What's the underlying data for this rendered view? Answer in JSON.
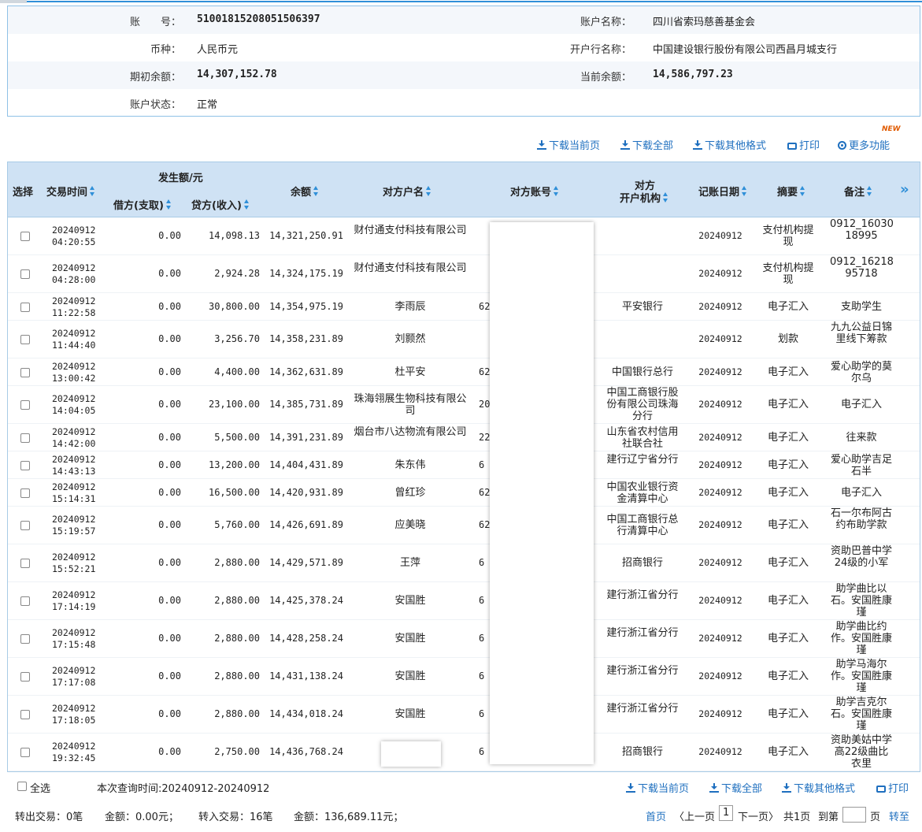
{
  "account": {
    "acct_no_label": "账　　号：",
    "acct_no": "51001815208051506397",
    "acct_name_label": "账户名称：",
    "acct_name": "四川省索玛慈善基金会",
    "currency_label": "币种：",
    "currency": "人民币元",
    "bank_label": "开户行名称：",
    "bank": "中国建设银行股份有限公司西昌月城支行",
    "open_bal_label": "期初余额：",
    "open_bal": "14,307,152.78",
    "cur_bal_label": "当前余额：",
    "cur_bal": "14,586,797.23",
    "status_label": "账户状态：",
    "status": "正常"
  },
  "toolbar": {
    "dl_page": "下载当前页",
    "dl_all": "下载全部",
    "dl_other": "下载其他格式",
    "print": "打印",
    "more": "更多功能",
    "new_badge": "NEW"
  },
  "columns": {
    "select": "选择",
    "time": "交易时间",
    "amount_group": "发生额/元",
    "debit": "借方(支取)",
    "credit": "贷方(收入)",
    "balance": "余额",
    "cp_name": "对方户名",
    "cp_acct": "对方账号",
    "cp_bank_1": "对方",
    "cp_bank_2": "开户机构",
    "book_date": "记账日期",
    "summary": "摘要",
    "remark": "备注",
    "more": "»"
  },
  "rows": [
    {
      "date": "20240912",
      "time": "04:20:55",
      "debit": "0.00",
      "credit": "14,098.13",
      "balance": "14,321,250.91",
      "name": "财付通支付科技有限公司",
      "frag": "",
      "bank": "",
      "book": "20240912",
      "summary": "支付机构提现",
      "remark": "0912_16030 18995"
    },
    {
      "date": "20240912",
      "time": "04:28:00",
      "debit": "0.00",
      "credit": "2,924.28",
      "balance": "14,324,175.19",
      "name": "财付通支付科技有限公司",
      "frag": "",
      "bank": "",
      "book": "20240912",
      "summary": "支付机构提现",
      "remark": "0912_16218 95718"
    },
    {
      "date": "20240912",
      "time": "11:22:58",
      "debit": "0.00",
      "credit": "30,800.00",
      "balance": "14,354,975.19",
      "name": "李雨辰",
      "frag": "62",
      "bank": "平安银行",
      "book": "20240912",
      "summary": "电子汇入",
      "remark": "支助学生"
    },
    {
      "date": "20240912",
      "time": "11:44:40",
      "debit": "0.00",
      "credit": "3,256.70",
      "balance": "14,358,231.89",
      "name": "刘颢然",
      "frag": "",
      "bank": "",
      "book": "20240912",
      "summary": "划款",
      "remark": "九九公益日锦里线下筹款"
    },
    {
      "date": "20240912",
      "time": "13:00:42",
      "debit": "0.00",
      "credit": "4,400.00",
      "balance": "14,362,631.89",
      "name": "杜平安",
      "frag": "62",
      "bank": "中国银行总行",
      "book": "20240912",
      "summary": "电子汇入",
      "remark": "爱心助学的莫尔乌"
    },
    {
      "date": "20240912",
      "time": "14:04:05",
      "debit": "0.00",
      "credit": "23,100.00",
      "balance": "14,385,731.89",
      "name": "珠海翎展生物科技有限公司",
      "frag": "20",
      "bank": "中国工商银行股份有限公司珠海分行",
      "book": "20240912",
      "summary": "电子汇入",
      "remark": "电子汇入"
    },
    {
      "date": "20240912",
      "time": "14:42:00",
      "debit": "0.00",
      "credit": "5,500.00",
      "balance": "14,391,231.89",
      "name": "烟台市八达物流有限公司",
      "frag": "22",
      "bank": "山东省农村信用社联合社",
      "book": "20240912",
      "summary": "电子汇入",
      "remark": "往来款"
    },
    {
      "date": "20240912",
      "time": "14:43:13",
      "debit": "0.00",
      "credit": "13,200.00",
      "balance": "14,404,431.89",
      "name": "朱东伟",
      "frag": "6",
      "bank": "建行辽宁省分行",
      "book": "20240912",
      "summary": "电子汇入",
      "remark": "爱心助学吉足石半"
    },
    {
      "date": "20240912",
      "time": "15:14:31",
      "debit": "0.00",
      "credit": "16,500.00",
      "balance": "14,420,931.89",
      "name": "曾红珍",
      "frag": "62",
      "bank": "中国农业银行资金清算中心",
      "book": "20240912",
      "summary": "电子汇入",
      "remark": "电子汇入"
    },
    {
      "date": "20240912",
      "time": "15:19:57",
      "debit": "0.00",
      "credit": "5,760.00",
      "balance": "14,426,691.89",
      "name": "应美晓",
      "frag": "62",
      "bank": "中国工商银行总行清算中心",
      "book": "20240912",
      "summary": "电子汇入",
      "remark": "石一尔布阿古约布助学款"
    },
    {
      "date": "20240912",
      "time": "15:52:21",
      "debit": "0.00",
      "credit": "2,880.00",
      "balance": "14,429,571.89",
      "name": "王萍",
      "frag": "6",
      "bank": "招商银行",
      "book": "20240912",
      "summary": "电子汇入",
      "remark": "资助巴普中学24级的小军"
    },
    {
      "date": "20240912",
      "time": "17:14:19",
      "debit": "0.00",
      "credit": "2,880.00",
      "balance": "14,425,378.24",
      "name": "安国胜",
      "frag": "6",
      "bank": "建行浙江省分行",
      "book": "20240912",
      "summary": "电子汇入",
      "remark": "助学曲比以石。安国胜康瑾"
    },
    {
      "date": "20240912",
      "time": "17:15:48",
      "debit": "0.00",
      "credit": "2,880.00",
      "balance": "14,428,258.24",
      "name": "安国胜",
      "frag": "6",
      "bank": "建行浙江省分行",
      "book": "20240912",
      "summary": "电子汇入",
      "remark": "助学曲比约作。安国胜康瑾"
    },
    {
      "date": "20240912",
      "time": "17:17:08",
      "debit": "0.00",
      "credit": "2,880.00",
      "balance": "14,431,138.24",
      "name": "安国胜",
      "frag": "6",
      "bank": "建行浙江省分行",
      "book": "20240912",
      "summary": "电子汇入",
      "remark": "助学马海尔作。安国胜康瑾"
    },
    {
      "date": "20240912",
      "time": "17:18:05",
      "debit": "0.00",
      "credit": "2,880.00",
      "balance": "14,434,018.24",
      "name": "安国胜",
      "frag": "6",
      "bank": "建行浙江省分行",
      "book": "20240912",
      "summary": "电子汇入",
      "remark": "助学吉克尔石。安国胜康瑾"
    },
    {
      "date": "20240912",
      "time": "19:32:45",
      "debit": "0.00",
      "credit": "2,750.00",
      "balance": "14,436,768.24",
      "name": "",
      "frag": "6",
      "bank": "招商银行",
      "book": "20240912",
      "summary": "电子汇入",
      "remark": "资助美姑中学高22级曲比衣里"
    }
  ],
  "footer": {
    "select_all": "全选",
    "query_time": "本次查询时间:20240912-20240912",
    "dl_page": "下载当前页",
    "dl_all": "下载全部",
    "dl_other": "下载其他格式",
    "print": "打印",
    "out_count": "转出交易：0笔",
    "out_amount": "金额：0.00元；",
    "in_count": "转入交易：16笔",
    "in_amount": "金额：136,689.11元；",
    "first": "首页",
    "prev": "〈上一页",
    "page_no": "1",
    "next": "下一页〉",
    "total": "共1页",
    "goto_prefix": "到第",
    "goto_suffix": "页",
    "go": "转至"
  }
}
